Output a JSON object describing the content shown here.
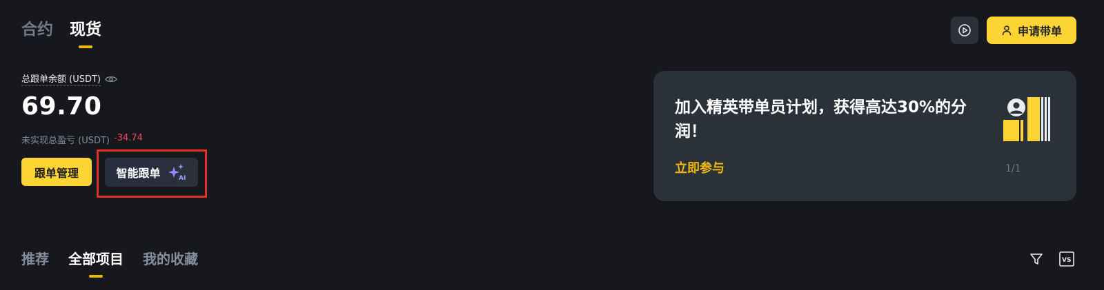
{
  "top_tabs": [
    {
      "label": "合约",
      "active": false
    },
    {
      "label": "现货",
      "active": true
    }
  ],
  "header": {
    "play_icon": "play-circle-icon",
    "apply_button": {
      "label": "申请带单",
      "icon": "user-icon"
    }
  },
  "summary": {
    "balance_label": "总跟单余额 (USDT)",
    "balance_value": "69.70",
    "pnl_label": "未实现总盈亏 (USDT)",
    "pnl_value": "-34.74",
    "manage_button": "跟单管理",
    "smart_button": "智能跟单",
    "smart_icon": "ai-sparkle-icon",
    "smart_icon_text": "AI"
  },
  "promo": {
    "title": "加入精英带单员计划，获得高达30%的分润！",
    "link": "立即参与",
    "pager": "1/1"
  },
  "bottom_tabs": [
    {
      "label": "推荐",
      "active": false
    },
    {
      "label": "全部项目",
      "active": true
    },
    {
      "label": "我的收藏",
      "active": false
    }
  ],
  "tools": {
    "filter_icon": "filter-icon",
    "compare_icon": "vs-icon",
    "compare_text": "VS"
  },
  "colors": {
    "background": "#17181e",
    "accent": "#fcd535",
    "negative": "#f6465d",
    "highlight_outline": "#e0312b"
  }
}
